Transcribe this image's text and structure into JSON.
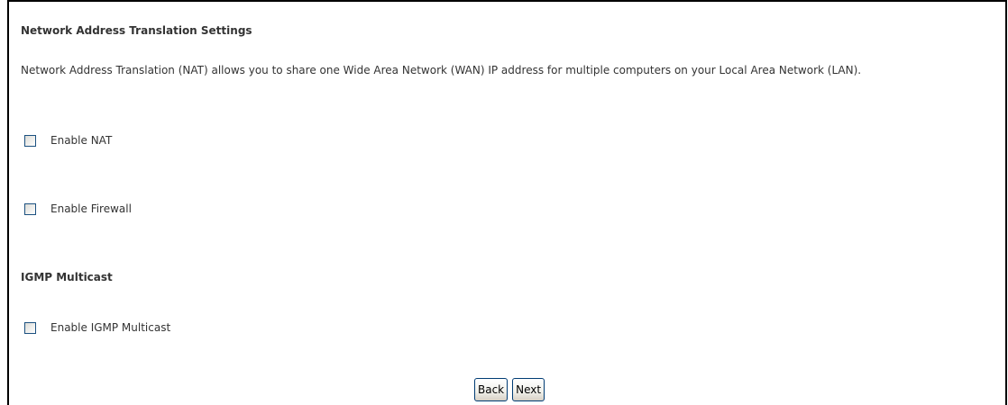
{
  "nat_section": {
    "title": "Network Address Translation Settings",
    "description": "Network Address Translation (NAT) allows you to share one Wide Area Network (WAN) IP address for multiple computers on your Local Area Network (LAN).",
    "enable_nat": {
      "label": "Enable NAT",
      "checked": false
    },
    "enable_firewall": {
      "label": "Enable Firewall",
      "checked": false
    }
  },
  "igmp_section": {
    "title": "IGMP Multicast",
    "enable_igmp": {
      "label": "Enable IGMP Multicast",
      "checked": false
    }
  },
  "buttons": {
    "back": "Back",
    "next": "Next"
  }
}
